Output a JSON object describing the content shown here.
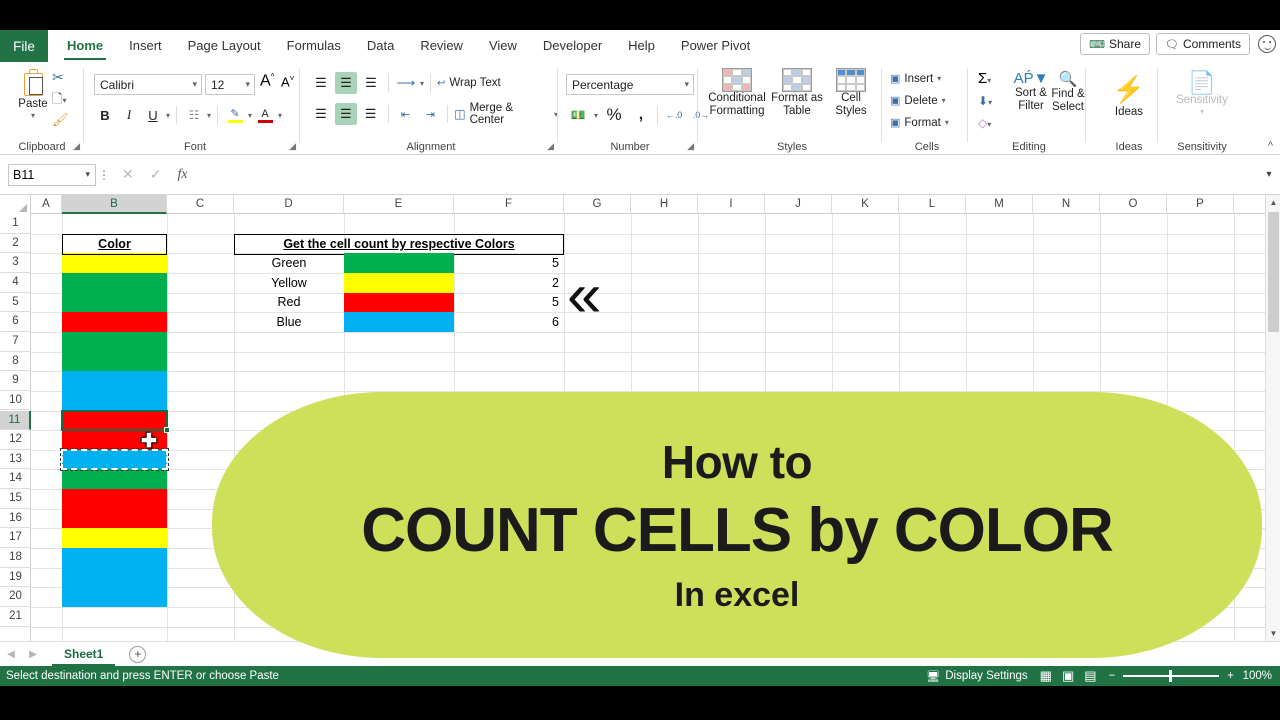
{
  "window": {
    "title": "Excel"
  },
  "ribbon": {
    "file_tab": "File",
    "tabs": [
      {
        "label": "Home",
        "active": true
      },
      {
        "label": "Insert",
        "active": false
      },
      {
        "label": "Page Layout",
        "active": false
      },
      {
        "label": "Formulas",
        "active": false
      },
      {
        "label": "Data",
        "active": false
      },
      {
        "label": "Review",
        "active": false
      },
      {
        "label": "View",
        "active": false
      },
      {
        "label": "Developer",
        "active": false
      },
      {
        "label": "Help",
        "active": false
      },
      {
        "label": "Power Pivot",
        "active": false
      }
    ],
    "share_label": "Share",
    "comments_label": "Comments",
    "collapse_icon": "chevron-up-icon",
    "groups": {
      "clipboard": {
        "name": "Clipboard",
        "paste_label": "Paste",
        "cut_icon": "scissors-icon",
        "copy_icon": "copy-icon",
        "format_painter_icon": "format-painter-icon"
      },
      "font": {
        "name": "Font",
        "font_family": "Calibri",
        "font_size": "12",
        "grow_font": "A",
        "shrink_font": "A",
        "bold": "B",
        "italic": "I",
        "underline": "U",
        "borders_icon": "borders-icon",
        "fill_color_icon": "fill-color-icon",
        "font_color_icon": "font-color-icon"
      },
      "alignment": {
        "name": "Alignment",
        "wrap_text": "Wrap Text",
        "merge_center": "Merge & Center",
        "orientation_icon": "orientation-icon",
        "decrease_indent_icon": "decrease-indent-icon",
        "increase_indent_icon": "increase-indent-icon"
      },
      "number": {
        "name": "Number",
        "format": "Percentage",
        "accounting_icon": "accounting-format-icon",
        "percent_style": "%",
        "comma_style": ",",
        "increase_decimal": ".00",
        "decrease_decimal": ".00"
      },
      "styles": {
        "name": "Styles",
        "conditional_formatting": "Conditional Formatting",
        "format_as_table": "Format as Table",
        "cell_styles": "Cell Styles"
      },
      "cells": {
        "name": "Cells",
        "insert": "Insert",
        "delete": "Delete",
        "format": "Format"
      },
      "editing": {
        "name": "Editing",
        "autosum_icon": "sigma-icon",
        "fill_icon": "fill-down-icon",
        "clear_icon": "eraser-icon",
        "sort_filter": "Sort & Filter",
        "find_select": "Find & Select"
      },
      "ideas": {
        "name": "Ideas",
        "label": "Ideas"
      },
      "sensitivity": {
        "name": "Sensitivity",
        "label": "Sensitivity"
      }
    }
  },
  "formula_bar": {
    "name_box": "B11",
    "cancel_icon": "x-icon",
    "enter_icon": "check-icon",
    "function_icon": "fx-icon",
    "formula_value": "",
    "expand_icon": "chevron-down-icon"
  },
  "grid": {
    "columns": [
      "A",
      "B",
      "C",
      "D",
      "E",
      "F",
      "G",
      "H",
      "I",
      "J",
      "K",
      "L",
      "M",
      "N",
      "O",
      "P"
    ],
    "selected_column": "B",
    "rows": [
      1,
      2,
      3,
      4,
      5,
      6,
      7,
      8,
      9,
      10,
      11,
      12,
      13,
      14,
      15,
      16,
      17,
      18,
      19,
      20,
      21
    ],
    "selected_row": 11,
    "active_cell": "B11",
    "copy_marquee_cell": "B13",
    "header_b2": "Color",
    "header_d2": "Get the cell count by respective Colors",
    "color_column": [
      {
        "row": 3,
        "color": "#FFFF00",
        "name": "Yellow"
      },
      {
        "row": 4,
        "color": "#00B050",
        "name": "Green"
      },
      {
        "row": 5,
        "color": "#00B050",
        "name": "Green"
      },
      {
        "row": 6,
        "color": "#FF0000",
        "name": "Red"
      },
      {
        "row": 7,
        "color": "#00B050",
        "name": "Green"
      },
      {
        "row": 8,
        "color": "#00B050",
        "name": "Green"
      },
      {
        "row": 9,
        "color": "#00B0F0",
        "name": "Blue"
      },
      {
        "row": 10,
        "color": "#00B0F0",
        "name": "Blue"
      },
      {
        "row": 11,
        "color": "#FF0000",
        "name": "Red"
      },
      {
        "row": 12,
        "color": "#FF0000",
        "name": "Red"
      },
      {
        "row": 13,
        "color": "#00B0F0",
        "name": "Blue"
      },
      {
        "row": 14,
        "color": "#00B050",
        "name": "Green"
      },
      {
        "row": 15,
        "color": "#FF0000",
        "name": "Red"
      },
      {
        "row": 16,
        "color": "#FF0000",
        "name": "Red"
      },
      {
        "row": 17,
        "color": "#FFFF00",
        "name": "Yellow"
      },
      {
        "row": 18,
        "color": "#00B0F0",
        "name": "Blue"
      },
      {
        "row": 19,
        "color": "#00B0F0",
        "name": "Blue"
      },
      {
        "row": 20,
        "color": "#00B0F0",
        "name": "Blue"
      }
    ],
    "summary_table": {
      "rows": [
        {
          "row": 3,
          "label": "Green",
          "swatch": "#00B050",
          "count": "5"
        },
        {
          "row": 4,
          "label": "Yellow",
          "swatch": "#FFFF00",
          "count": "2"
        },
        {
          "row": 5,
          "label": "Red",
          "swatch": "#FF0000",
          "count": "5"
        },
        {
          "row": 6,
          "label": "Blue",
          "swatch": "#00B0F0",
          "count": "6"
        }
      ]
    },
    "annotation_icon": "double-chevron-left-icon",
    "annotation_glyph": "«"
  },
  "sheet_tabs": {
    "prev_icon": "nav-prev-icon",
    "next_icon": "nav-next-icon",
    "tabs": [
      {
        "label": "Sheet1",
        "active": true
      }
    ],
    "add_sheet_icon": "plus-circle-icon"
  },
  "status_bar": {
    "message": "Select destination and press ENTER or choose Paste",
    "display_settings": "Display Settings",
    "view_normal_icon": "normal-view-icon",
    "view_layout_icon": "page-layout-view-icon",
    "view_break_icon": "page-break-view-icon",
    "zoom_out": "−",
    "zoom_in": "+",
    "zoom_level": "100%"
  },
  "overlay_banner": {
    "line1": "How to",
    "line2": "COUNT CELLS by COLOR",
    "line3": "In excel",
    "background_color": "#CEE05A",
    "text_color": "#1B1B1B"
  }
}
